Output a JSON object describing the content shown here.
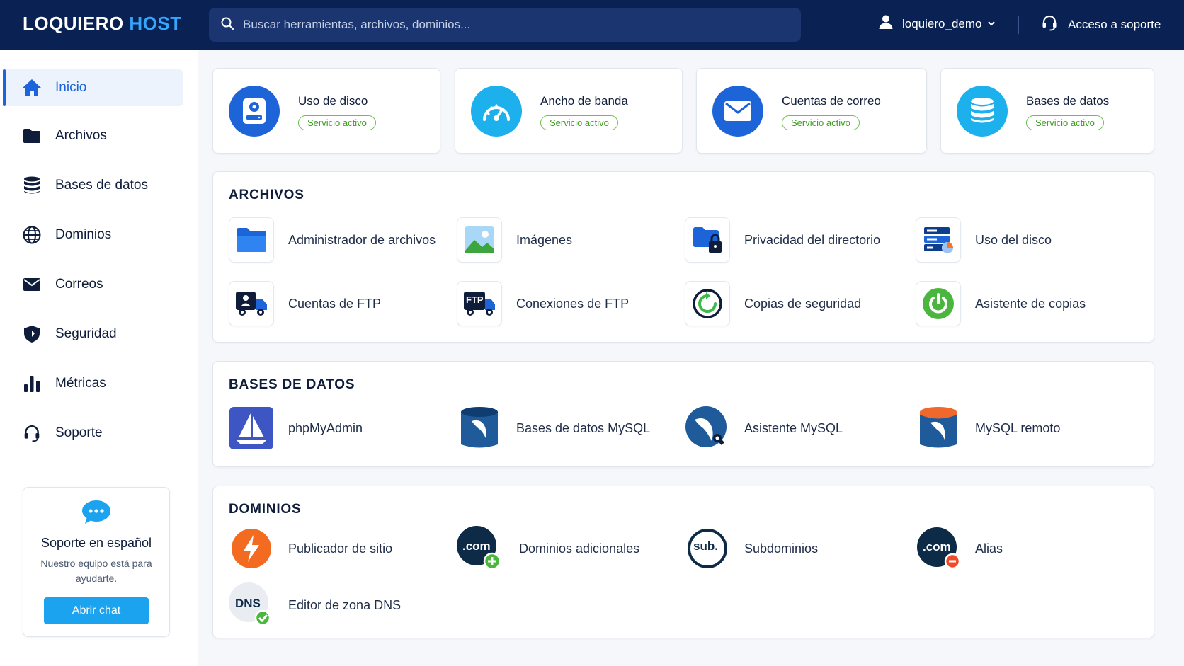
{
  "brand": {
    "part1": "LOQUIERO",
    "part2": "HOST",
    "accent_color": "#35a6ff"
  },
  "header": {
    "search_placeholder": "Buscar herramientas, archivos, dominios...",
    "user": "loquiero_demo",
    "support": "Acceso a soporte"
  },
  "sidebar": {
    "items": [
      {
        "label": "Inicio",
        "icon": "home-icon",
        "active": true
      },
      {
        "label": "Archivos",
        "icon": "folder-icon"
      },
      {
        "label": "Bases de datos",
        "icon": "database-icon"
      },
      {
        "label": "Dominios",
        "icon": "globe-icon"
      },
      {
        "label": "Correos",
        "icon": "envelope-icon"
      },
      {
        "label": "Seguridad",
        "icon": "shield-icon"
      },
      {
        "label": "Métricas",
        "icon": "bar-chart-icon"
      },
      {
        "label": "Soporte",
        "icon": "headset-icon"
      }
    ],
    "help": {
      "title": "Soporte en español",
      "subtitle": "Nuestro equipo está para ayudarte.",
      "button": "Abrir chat"
    }
  },
  "stats": [
    {
      "label": "Uso de disco",
      "status": "Servicio activo",
      "icon": "disk-icon",
      "color": "#1d64d8"
    },
    {
      "label": "Ancho de banda",
      "status": "Servicio activo",
      "icon": "speedometer-icon",
      "color": "#1cb1ec"
    },
    {
      "label": "Cuentas de correo",
      "status": "Servicio activo",
      "icon": "mail-icon",
      "color": "#1d64d8"
    },
    {
      "label": "Bases de datos",
      "status": "Servicio activo",
      "icon": "database-icon",
      "color": "#1cb1ec"
    }
  ],
  "sections": {
    "archivos": {
      "title": "ARCHIVOS",
      "tools": [
        "Administrador de archivos",
        "Imágenes",
        "Privacidad del directorio",
        "Uso del disco",
        "Cuentas de FTP",
        "Conexiones de FTP",
        "Copias de seguridad",
        "Asistente de copias"
      ]
    },
    "bases": {
      "title": "BASES DE DATOS",
      "tools": [
        "phpMyAdmin",
        "Bases de datos MySQL",
        "Asistente MySQL",
        "MySQL remoto"
      ]
    },
    "dominios": {
      "title": "DOMINIOS",
      "tools": [
        "Publicador de sitio",
        "Dominios adicionales",
        "Subdominios",
        "Alias",
        "Editor de zona DNS"
      ],
      "icon_text": {
        "com": ".com",
        "sub": "sub.",
        "dns": "DNS"
      }
    },
    "ftp_badge": "FTP"
  }
}
